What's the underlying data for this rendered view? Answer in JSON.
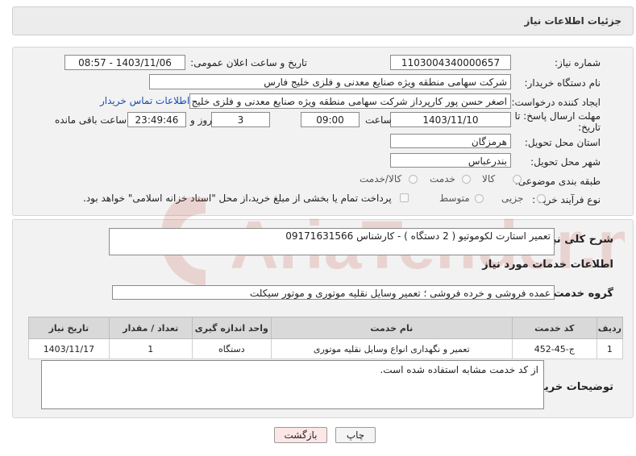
{
  "header": {
    "title": "جزئیات اطلاعات نیاز"
  },
  "fields": {
    "need_number_label": "شماره نیاز:",
    "need_number": "1103004340000657",
    "announce_label": "تاریخ و ساعت اعلان عمومی:",
    "announce_value": "1403/11/06 - 08:57",
    "buyer_label": "نام دستگاه خریدار:",
    "buyer_value": "شرکت سهامی منطقه ویژه صنایع معدنی و فلزی خلیج فارس",
    "creator_label": "ایجاد کننده درخواست:",
    "creator_value": "اصغر حسن پور کارپرداز شرکت سهامی منطقه ویژه صنایع معدنی و فلزی خلیج فا",
    "contact_link": "اطلاعات تماس خریدار",
    "deadline_label_1": "مهلت ارسال پاسخ: تا",
    "deadline_label_2": "تاریخ:",
    "deadline_date": "1403/11/10",
    "time_label": "ساعت",
    "deadline_time": "09:00",
    "days_value": "3",
    "days_label": "روز و",
    "remaining_time": "23:49:46",
    "remaining_label": "ساعت باقی مانده",
    "province_label": "استان محل تحویل:",
    "province_value": "هرمزگان",
    "city_label": "شهر محل تحویل:",
    "city_value": "بندرعباس",
    "category_label": "طبقه بندی موضوعی:",
    "category_options": [
      "کالا",
      "خدمت",
      "کالا/خدمت"
    ],
    "process_label": "نوع فرآیند خرید :",
    "process_options": [
      "جزیی",
      "متوسط"
    ],
    "payment_note": "پرداخت تمام یا بخشی از مبلغ خرید،از محل \"اسناد خزانه اسلامی\" خواهد بود."
  },
  "summary": {
    "label": "شرح کلی نیاز:",
    "value": "تعمیر استارت لکوموتیو ( 2 دستگاه ) - کارشناس 09171631566"
  },
  "services_section": {
    "title": "اطلاعات خدمات مورد نیاز",
    "group_label": "گروه خدمت:",
    "group_value": "عمده فروشی و خرده فروشی ؛ تعمیر وسایل نقلیه موتوری و موتور سیکلت"
  },
  "table": {
    "headers": [
      "ردیف",
      "کد خدمت",
      "نام خدمت",
      "واحد اندازه گیری",
      "تعداد / مقدار",
      "تاریخ نیاز"
    ],
    "rows": [
      [
        "1",
        "ج-45-452",
        "تعمیر و نگهداری انواع وسایل نقلیه موتوری",
        "دستگاه",
        "1",
        "1403/11/17"
      ]
    ]
  },
  "buyer_notes": {
    "label": "توضیحات خریدار:",
    "value": "از کد خدمت مشابه استفاده شده است."
  },
  "buttons": {
    "print": "چاپ",
    "back": "بازگشت"
  },
  "watermark": {
    "text": "AriaTender.neT"
  },
  "colors": {
    "link": "#1a4db3",
    "back_button_bg": "#fde6e6",
    "watermark": "#c0392b"
  }
}
